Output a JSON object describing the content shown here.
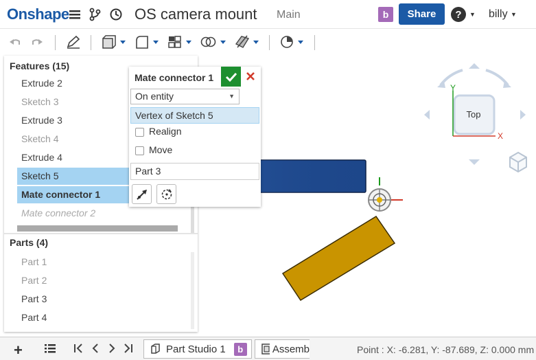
{
  "header": {
    "logo": "Onshape",
    "title": "OS camera mount",
    "workspace": "Main",
    "branch_badge": "b",
    "share_label": "Share",
    "help_label": "?",
    "user": "billy"
  },
  "features_panel": {
    "title": "Features (15)",
    "items": [
      {
        "label": "Extrude 2"
      },
      {
        "label": "Sketch 3"
      },
      {
        "label": "Extrude 3"
      },
      {
        "label": "Sketch 4"
      },
      {
        "label": "Extrude 4"
      },
      {
        "label": "Sketch 5"
      },
      {
        "label": "Mate connector 1"
      },
      {
        "label": "Mate connector 2"
      }
    ]
  },
  "parts_panel": {
    "title": "Parts (4)",
    "items": [
      {
        "label": "Part 1"
      },
      {
        "label": "Part 2"
      },
      {
        "label": "Part 3"
      },
      {
        "label": "Part 4"
      }
    ]
  },
  "dialog": {
    "title": "Mate connector 1",
    "origin_type": "On entity",
    "origin_entity": "Vertex of Sketch 5",
    "realign_label": "Realign",
    "move_label": "Move",
    "owner_part": "Part 3"
  },
  "view_cube": {
    "face": "Top",
    "x_label": "X",
    "y_label": "Y"
  },
  "bottom": {
    "tab1_label": "Part Studio 1",
    "tab1_badge": "b",
    "tab2_label": "Assemb",
    "status": "Point : X: -6.281, Y: -87.689, Z: 0.000 mm"
  },
  "colors": {
    "brand": "#1b5aa6",
    "badge": "#a46ab8",
    "selection": "#a4d3f2",
    "confirm": "#1d8f2f",
    "part_blue": "#1f4a8f",
    "part_gold": "#c99400"
  }
}
